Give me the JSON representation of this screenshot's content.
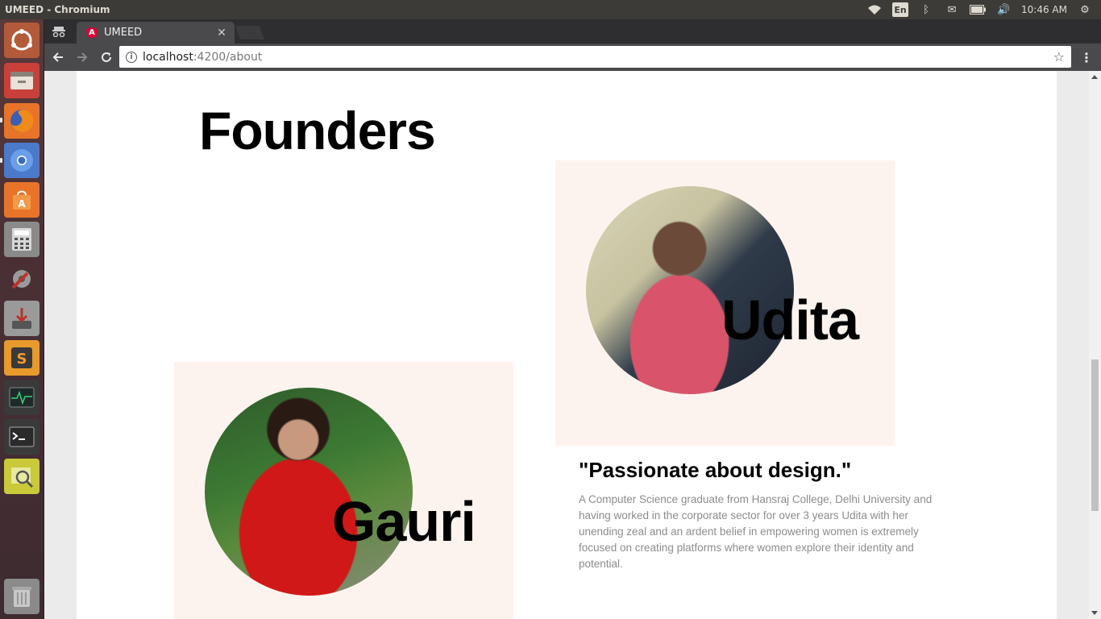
{
  "system": {
    "window_title": "UMEED - Chromium",
    "keyboard_layout": "En",
    "clock": "10:46 AM"
  },
  "launcher": {
    "items": [
      {
        "name": "ubuntu-dash-icon",
        "color": "#b35a3a"
      },
      {
        "name": "files-icon",
        "color": "#c9403a"
      },
      {
        "name": "firefox-icon",
        "color": "#e8742a"
      },
      {
        "name": "chromium-icon",
        "color": "#4a7ac9"
      },
      {
        "name": "software-center-icon",
        "color": "#e8742a"
      },
      {
        "name": "calculator-icon",
        "color": "#8a8a8a"
      },
      {
        "name": "system-settings-icon",
        "color": "#6a6a6a"
      },
      {
        "name": "software-updater-icon",
        "color": "#9a9a9a"
      },
      {
        "name": "sublime-text-icon",
        "color": "#e89a2a"
      },
      {
        "name": "system-monitor-icon",
        "color": "#3a3a3a"
      },
      {
        "name": "terminal-icon",
        "color": "#3a3a3a"
      },
      {
        "name": "image-viewer-icon",
        "color": "#c9c93a"
      },
      {
        "name": "trash-icon",
        "color": "#8a8a8a"
      }
    ]
  },
  "browser": {
    "tab_title": "UMEED",
    "url_host": "localhost",
    "url_path": ":4200/about"
  },
  "page": {
    "heading": "Founders",
    "founders": [
      {
        "name": "Udita",
        "quote": "\"Passionate about design.\"",
        "bio": "A Computer Science graduate from Hansraj College, Delhi University and having worked in the corporate sector for over 3 years Udita with her unending zeal and an ardent belief in empowering women is extremely focused on creating platforms where women explore their identity and potential."
      },
      {
        "name": "Gauri"
      }
    ]
  },
  "colors": {
    "card_background": "#fdf3ee",
    "bio_text": "#8c8c8c"
  }
}
